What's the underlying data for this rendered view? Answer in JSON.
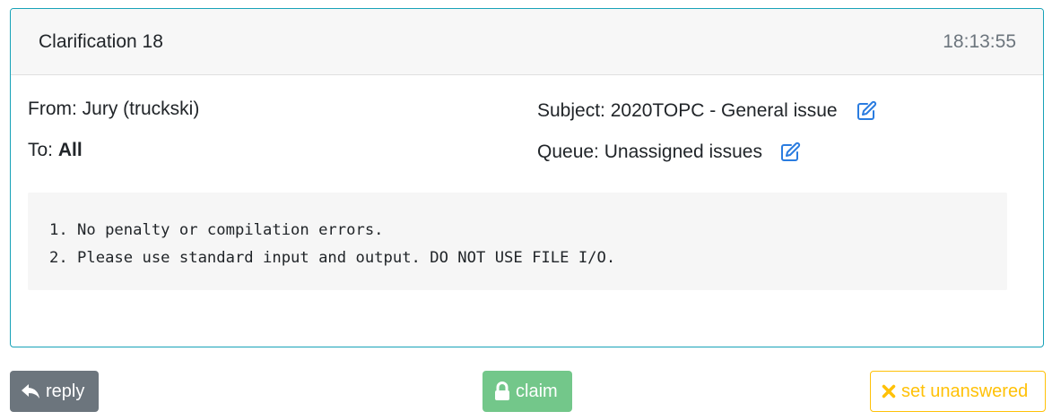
{
  "header": {
    "title": "Clarification 18",
    "time": "18:13:55"
  },
  "meta": {
    "from": "From: Jury (truckski)",
    "to_label": "To: ",
    "to_value": "All",
    "subject": "Subject: 2020TOPC - General issue",
    "queue": "Queue: Unassigned issues"
  },
  "message": {
    "lines": [
      "1. No penalty or compilation errors.",
      "2. Please use standard input and output. DO NOT USE FILE I/O."
    ]
  },
  "actions": {
    "reply_label": "reply",
    "claim_label": "claim",
    "unanswered_label": "set unanswered"
  },
  "icons": {
    "edit": "edit-icon",
    "reply": "reply-icon",
    "lock": "lock-icon",
    "close": "close-icon"
  },
  "colors": {
    "card_border": "#17a2b8",
    "edit_icon": "#2a7ce0",
    "reply_button": "#6c757d",
    "claim_button": "#73c78a",
    "warning": "#ffc107"
  }
}
